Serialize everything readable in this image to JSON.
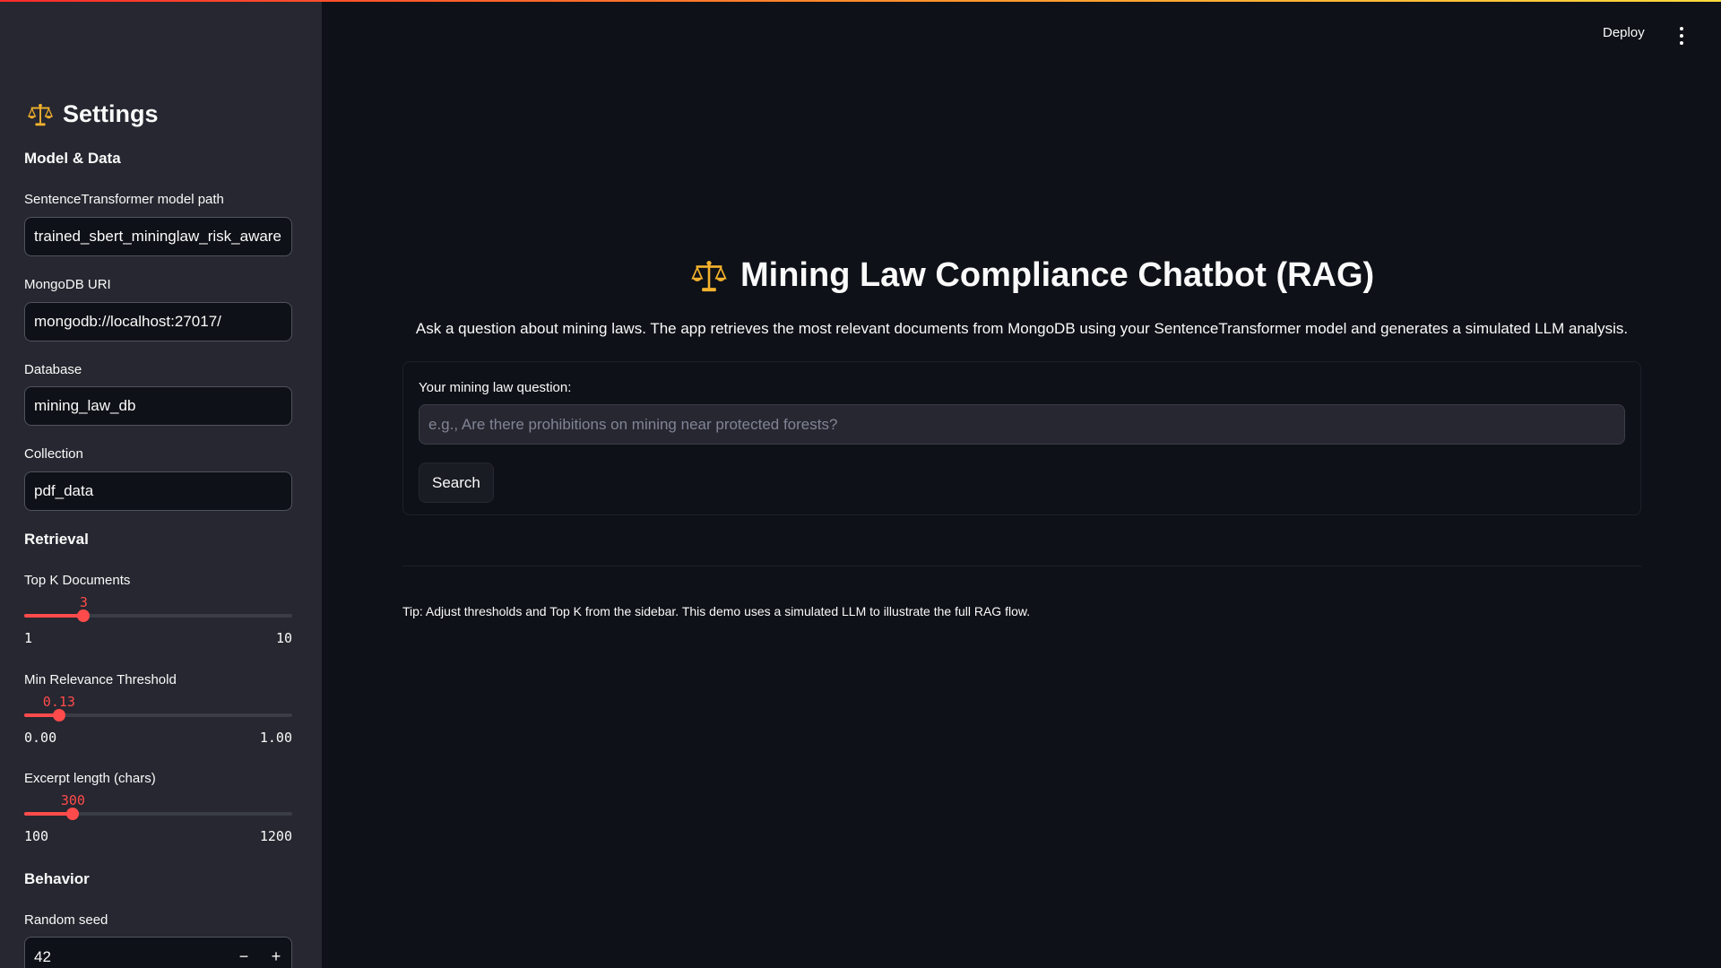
{
  "colors": {
    "accent": "#ff4b4b",
    "background": "#0e1117",
    "sidebar": "#262730",
    "icon_gold": "#f5b22e"
  },
  "header": {
    "deploy_label": "Deploy",
    "menu_icon": "kebab-menu-icon"
  },
  "sidebar": {
    "title": "Settings",
    "title_icon": "balance-scale-icon",
    "sections": {
      "model_data": "Model & Data",
      "retrieval": "Retrieval",
      "behavior": "Behavior"
    },
    "model_path": {
      "label": "SentenceTransformer model path",
      "value": "trained_sbert_mininglaw_risk_aware"
    },
    "mongodb_uri": {
      "label": "MongoDB URI",
      "value": "mongodb://localhost:27017/"
    },
    "database": {
      "label": "Database",
      "value": "mining_law_db"
    },
    "collection": {
      "label": "Collection",
      "value": "pdf_data"
    },
    "top_k": {
      "label": "Top K Documents",
      "value": "3",
      "min": "1",
      "max": "10",
      "fraction": 0.222
    },
    "min_relevance": {
      "label": "Min Relevance Threshold",
      "value": "0.13",
      "min": "0.00",
      "max": "1.00",
      "fraction": 0.13
    },
    "excerpt_length": {
      "label": "Excerpt length (chars)",
      "value": "300",
      "min": "100",
      "max": "1200",
      "fraction": 0.182
    },
    "random_seed": {
      "label": "Random seed",
      "value": "42",
      "minus": "−",
      "plus": "+"
    }
  },
  "main": {
    "title": "Mining Law Compliance Chatbot (RAG)",
    "title_icon": "balance-scale-icon",
    "description": "Ask a question about mining laws. The app retrieves the most relevant documents from MongoDB using your SentenceTransformer model and generates a simulated LLM analysis.",
    "question_label": "Your mining law question:",
    "question_value": "",
    "question_placeholder": "e.g., Are there prohibitions on mining near protected forests?",
    "search_label": "Search",
    "tip": "Tip: Adjust thresholds and Top K from the sidebar. This demo uses a simulated LLM to illustrate the full RAG flow."
  }
}
